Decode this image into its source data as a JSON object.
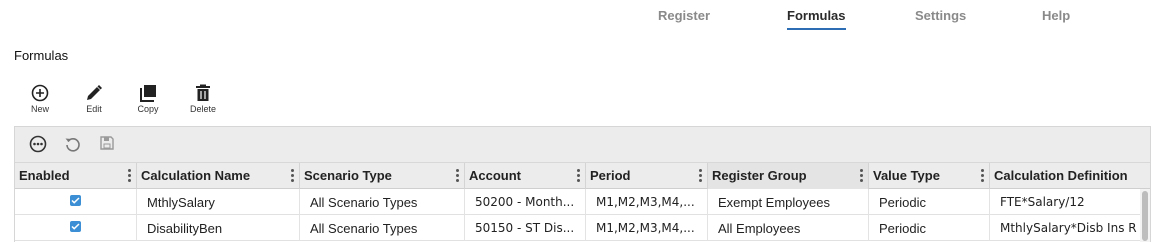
{
  "nav": {
    "tabs": [
      {
        "label": "Register",
        "active": false
      },
      {
        "label": "Formulas",
        "active": true
      },
      {
        "label": "Settings",
        "active": false
      },
      {
        "label": "Help",
        "active": false
      }
    ]
  },
  "page": {
    "title": "Formulas"
  },
  "toolbar": {
    "new_label": "New",
    "edit_label": "Edit",
    "copy_label": "Copy",
    "delete_label": "Delete"
  },
  "grid": {
    "columns": [
      {
        "label": "Enabled"
      },
      {
        "label": "Calculation Name"
      },
      {
        "label": "Scenario Type"
      },
      {
        "label": "Account"
      },
      {
        "label": "Period"
      },
      {
        "label": "Register Group"
      },
      {
        "label": "Value Type"
      },
      {
        "label": "Calculation Definition"
      }
    ],
    "rows": [
      {
        "enabled": true,
        "name": "MthlySalary",
        "scenario": "All Scenario Types",
        "account": "50200 - Month...",
        "period": "M1,M2,M3,M4,...",
        "group": "Exempt Employees",
        "value_type": "Periodic",
        "definition": "FTE*Salary/12"
      },
      {
        "enabled": true,
        "name": "DisabilityBen",
        "scenario": "All Scenario Types",
        "account": "50150 - ST Dis...",
        "period": "M1,M2,M3,M4,...",
        "group": "All Employees",
        "value_type": "Periodic",
        "definition": "MthlySalary*Disb Ins R"
      }
    ]
  },
  "colors": {
    "accent": "#2d6db3",
    "checkbox": "#3c8fd4",
    "header_bg": "#ececec"
  }
}
